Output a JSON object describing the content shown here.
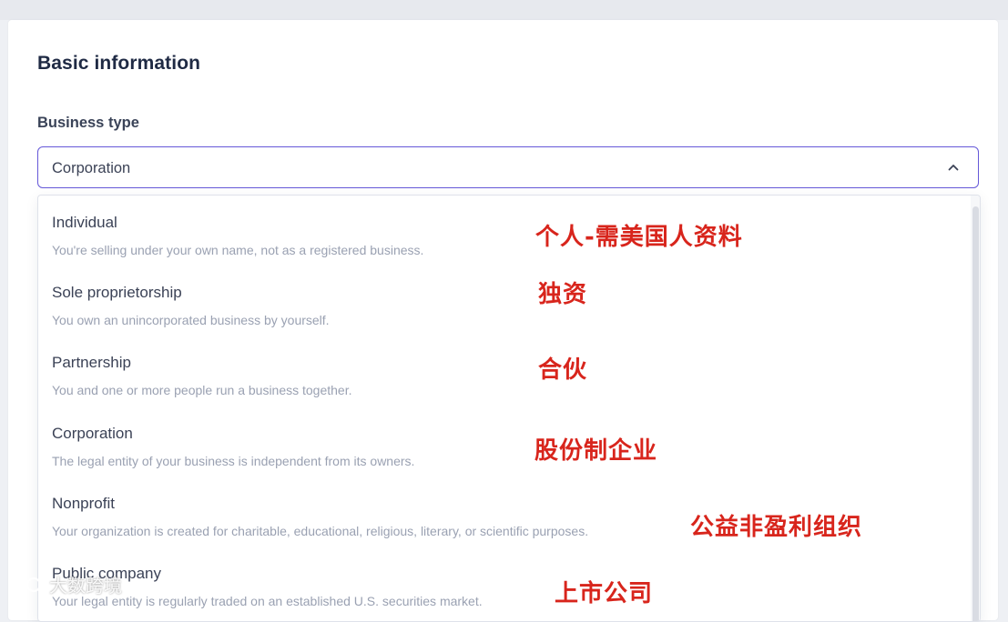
{
  "section": {
    "title": "Basic information"
  },
  "field": {
    "label": "Business type",
    "selected_value": "Corporation"
  },
  "dropdown": {
    "options": [
      {
        "title": "Individual",
        "description": "You're selling under your own name, not as a registered business.",
        "annotation": "个人-需美国人资料"
      },
      {
        "title": "Sole proprietorship",
        "description": "You own an unincorporated business by yourself.",
        "annotation": "独资"
      },
      {
        "title": "Partnership",
        "description": "You and one or more people run a business together.",
        "annotation": "合伙"
      },
      {
        "title": "Corporation",
        "description": "The legal entity of your business is independent from its owners.",
        "annotation": "股份制企业"
      },
      {
        "title": "Nonprofit",
        "description": "Your organization is created for charitable, educational, religious, literary, or scientific purposes.",
        "annotation": "公益非盈利组织"
      },
      {
        "title": "Public company",
        "description": "Your legal entity is regularly traded on an established U.S. securities market.",
        "annotation": "上市公司"
      }
    ]
  },
  "watermark": {
    "text": "大数跨境"
  },
  "colors": {
    "focus_border": "#6558d8",
    "annotation": "#d8251c",
    "title": "#1f2a44"
  }
}
